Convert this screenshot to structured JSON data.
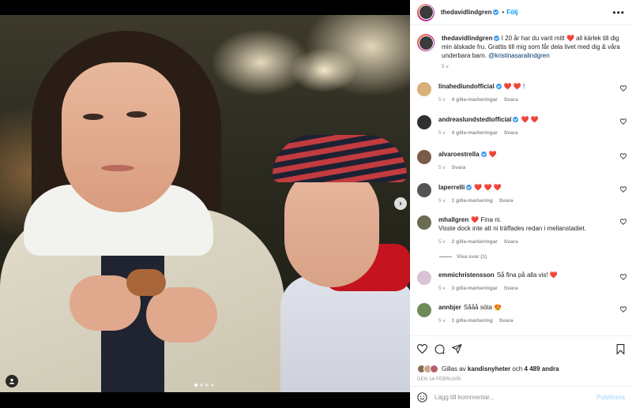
{
  "post": {
    "author": "thedavidlindgren",
    "follow_label": "Följ",
    "separator": "•",
    "more_icon": "more-horizontal-icon"
  },
  "caption": {
    "author": "thedavidlindgren",
    "text_part1": "I 20 år har du varit mitt",
    "text_part2": "all kärlek till dig min älskade fru. Grattis till mig som får dela livet med dig & våra underbara barn.",
    "mention": "@kristinasaralindgren",
    "heart": "❤️",
    "time": "5 v"
  },
  "comments": [
    {
      "user": "linahedlundofficial",
      "verified": true,
      "text": "❤️ ❤️ !",
      "time": "5 v",
      "likes": "4 gilla-markeringar",
      "reply": "Svara",
      "avatar_color": "#d9b07a"
    },
    {
      "user": "andreaslundstedtofficial",
      "verified": true,
      "text": "❤️ ❤️",
      "time": "5 v",
      "likes": "4 gilla-markeringar",
      "reply": "Svara",
      "avatar_color": "#2f2f2f"
    },
    {
      "user": "alvaroestrella",
      "verified": true,
      "text": "❤️",
      "time": "5 v",
      "likes": "",
      "reply": "Svara",
      "avatar_color": "#7a5b47"
    },
    {
      "user": "laperrelli",
      "verified": true,
      "text": "❤️ ❤️ ❤️",
      "time": "5 v",
      "likes": "1 gilla-markering",
      "reply": "Svara",
      "avatar_color": "#545454"
    },
    {
      "user": "mhallgren",
      "verified": false,
      "text": "❤️  Fina ni.\nVisste dock inte att ni träffades redan i mellanstadiet.",
      "time": "5 v",
      "likes": "2 gilla-markeringar",
      "reply": "Svara",
      "avatar_color": "#6b6b52"
    },
    {
      "user": "emmichristensson",
      "verified": false,
      "text": "Så fina på alla vis! ❤️",
      "time": "5 v",
      "likes": "3 gilla-markeringar",
      "reply": "Svara",
      "avatar_color": "#d8c3d6"
    },
    {
      "user": "annbjer",
      "verified": false,
      "text": "Sååå söta 😍",
      "time": "5 v",
      "likes": "1 gilla-markering",
      "reply": "Svara",
      "avatar_color": "#6f8a5a"
    }
  ],
  "view_replies": "Visa svar (1)",
  "actions": {
    "like_icon": "heart-outline-icon",
    "comment_icon": "comment-icon",
    "share_icon": "share-icon",
    "save_icon": "bookmark-icon"
  },
  "likes_line": {
    "prefix": "Gillas av",
    "user": "kandisnyheter",
    "middle": "och",
    "count": "4 489 andra"
  },
  "date": "DEN 14 FEBRUARI",
  "add_comment": {
    "placeholder": "Lägg till kommentar...",
    "publish": "Publicera",
    "emoji_icon": "smiley-icon"
  },
  "carousel": {
    "slides": 4,
    "active": 1
  }
}
